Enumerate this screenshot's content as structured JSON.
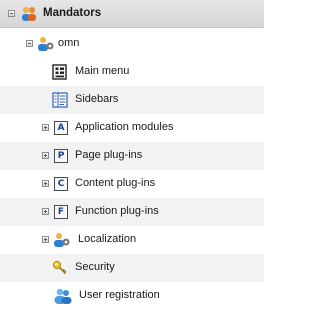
{
  "tree": {
    "root": {
      "label": "Mandators"
    },
    "mandator": {
      "label": "omn"
    },
    "items": [
      {
        "label": "Main menu"
      },
      {
        "label": "Sidebars"
      },
      {
        "label": "Application modules",
        "letter": "A"
      },
      {
        "label": "Page plug-ins",
        "letter": "P"
      },
      {
        "label": "Content plug-ins",
        "letter": "C"
      },
      {
        "label": "Function plug-ins",
        "letter": "F"
      },
      {
        "label": "Localization"
      },
      {
        "label": "Security"
      },
      {
        "label": "User registration"
      }
    ]
  },
  "colors": {
    "header_bg": "#dcdcdc",
    "alt_row_bg": "#f2f2f2",
    "icon_blue": "#2b5fb4",
    "icon_orange": "#f39a1e"
  }
}
